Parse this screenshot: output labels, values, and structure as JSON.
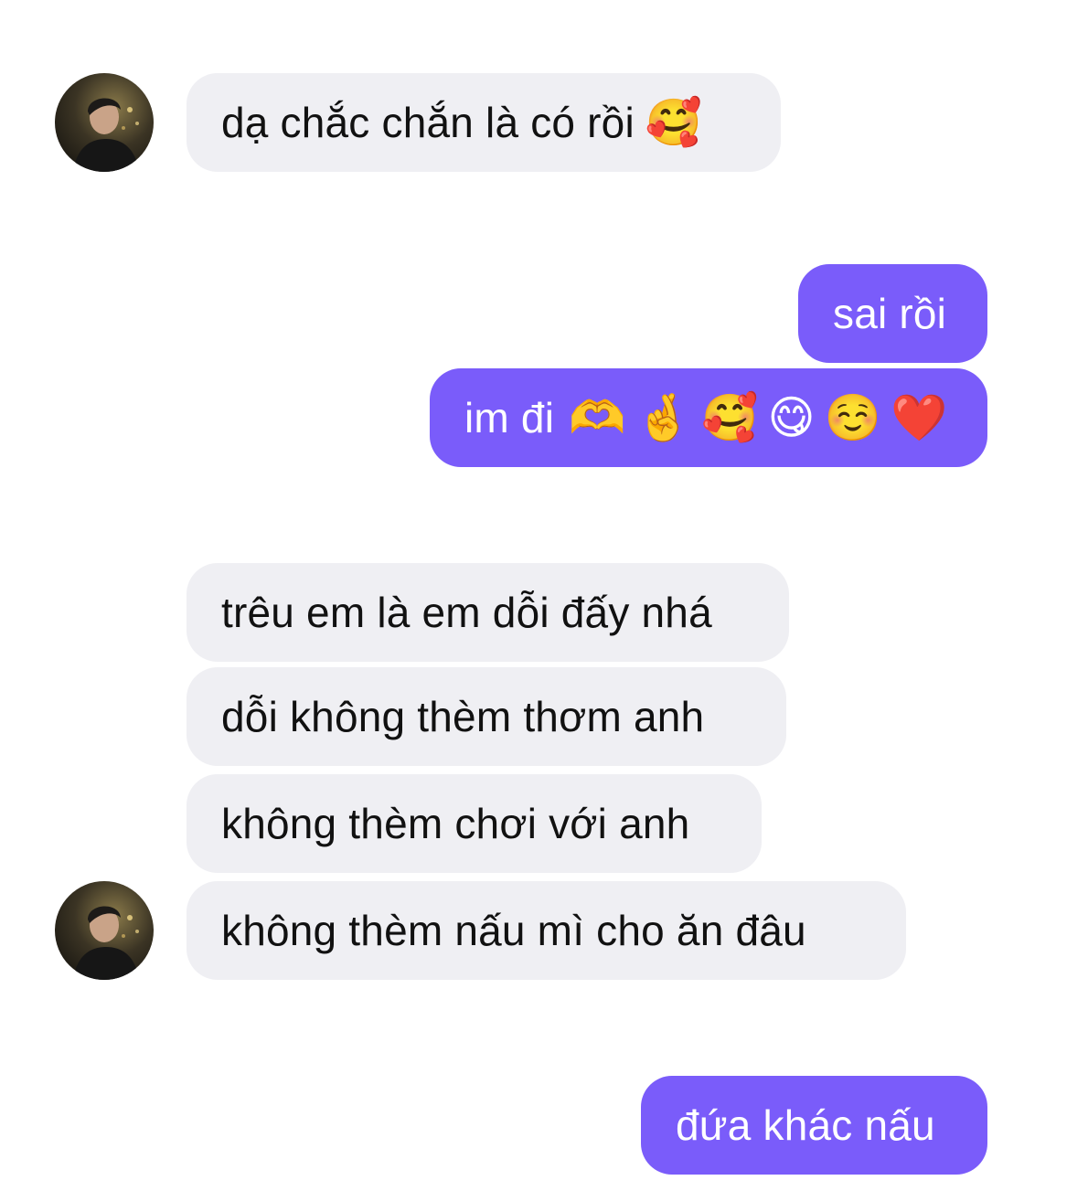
{
  "conversation": {
    "messages": [
      {
        "sender": "them",
        "text": "dạ chắc chắn là có rồi",
        "emojis": [
          "🥰"
        ]
      },
      {
        "sender": "me",
        "text": "sai rồi",
        "emojis": []
      },
      {
        "sender": "me",
        "text": "im đi",
        "emojis": [
          "🫶",
          "🤞",
          "🥰",
          "😋",
          "☺️",
          "❤️"
        ]
      },
      {
        "sender": "them",
        "text": "trêu em là em dỗi đấy nhá",
        "emojis": []
      },
      {
        "sender": "them",
        "text": "dỗi không thèm thơm anh",
        "emojis": []
      },
      {
        "sender": "them",
        "text": "không thèm chơi với anh",
        "emojis": []
      },
      {
        "sender": "them",
        "text": "không thèm nấu mì cho ăn đâu",
        "emojis": []
      },
      {
        "sender": "me",
        "text": "đứa khác nấu",
        "emojis": []
      }
    ]
  },
  "colors": {
    "incoming_bubble": "#efeff3",
    "outgoing_bubble": "#7a5cfa",
    "incoming_text": "#111111",
    "outgoing_text": "#ffffff"
  }
}
